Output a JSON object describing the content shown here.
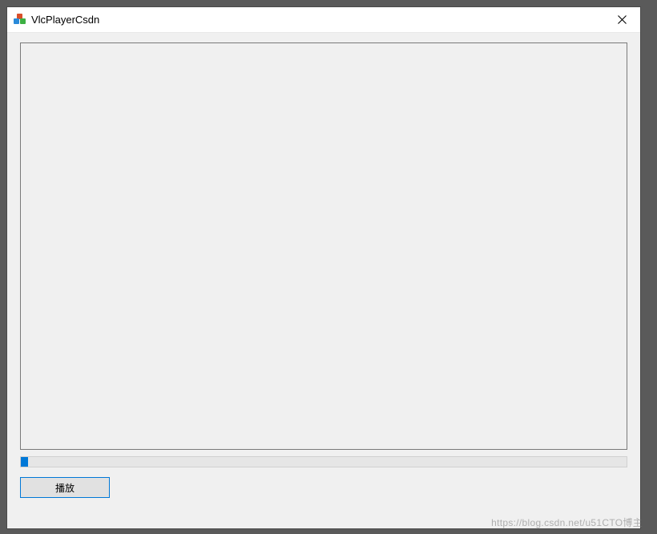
{
  "window": {
    "title": "VlcPlayerCsdn"
  },
  "progress": {
    "percent": 1.2
  },
  "controls": {
    "play_label": "播放"
  },
  "watermark": {
    "text": "https://blog.csdn.net/u51CTO博主"
  }
}
